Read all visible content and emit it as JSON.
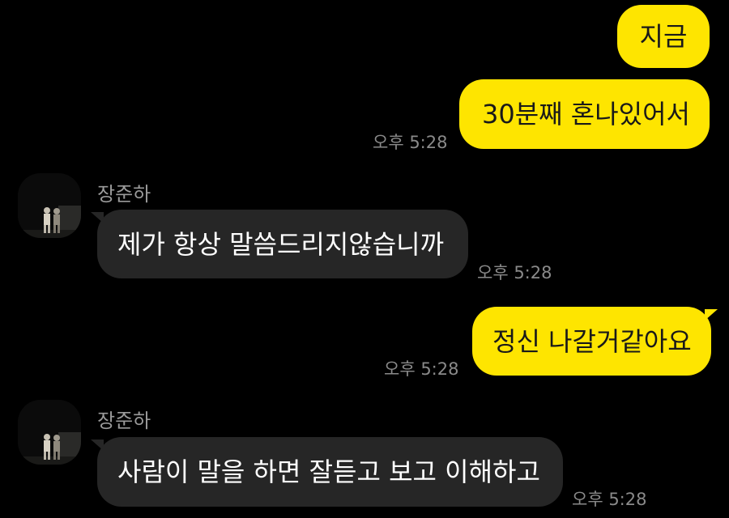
{
  "messages": [
    {
      "from": "me",
      "text": "지금"
    },
    {
      "from": "me",
      "text": "30분째 혼나있어서",
      "time": "오후 5:28"
    },
    {
      "from": "them",
      "sender": "장준하",
      "text": "제가 항상 말씀드리지않습니까",
      "time": "오후 5:28"
    },
    {
      "from": "me",
      "text": "정신 나갈거같아요",
      "time": "오후 5:28"
    },
    {
      "from": "them",
      "sender": "장준하",
      "text": "사람이 말을 하면 잘듣고 보고 이해하고",
      "time": "오후 5:28"
    }
  ],
  "colors": {
    "background": "#000000",
    "my_bubble": "#fee500",
    "their_bubble": "#262626",
    "timestamp": "#8a8a8a"
  },
  "icons": {
    "avatar": "profile-photo-two-figures"
  }
}
